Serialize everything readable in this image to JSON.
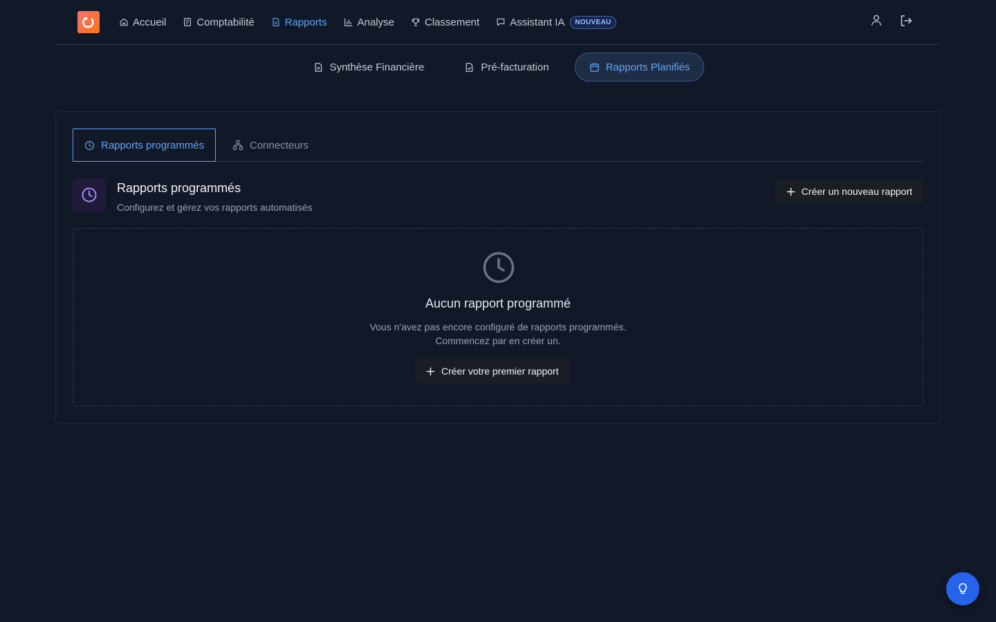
{
  "nav": {
    "items": [
      {
        "label": "Accueil",
        "icon": "home-icon"
      },
      {
        "label": "Comptabilité",
        "icon": "receipt-icon"
      },
      {
        "label": "Rapports",
        "icon": "file-text-icon",
        "active": true
      },
      {
        "label": "Analyse",
        "icon": "bar-chart-icon"
      },
      {
        "label": "Classement",
        "icon": "trophy-icon"
      },
      {
        "label": "Assistant IA",
        "icon": "chat-icon"
      }
    ],
    "badge": "NOUVEAU",
    "active_color": "#60a5fa"
  },
  "subnav": {
    "tabs": [
      {
        "label": "Synthèse Financière",
        "icon": "file-text-icon"
      },
      {
        "label": "Pré-facturation",
        "icon": "file-check-icon"
      },
      {
        "label": "Rapports Planifiés",
        "icon": "calendar-icon",
        "active": true
      }
    ]
  },
  "card": {
    "tabs": [
      {
        "label": "Rapports programmés",
        "icon": "clock-icon",
        "active": true
      },
      {
        "label": "Connecteurs",
        "icon": "network-icon"
      }
    ],
    "section": {
      "title": "Rapports programmés",
      "subtitle": "Configurez et gérez vos rapports automatisés",
      "new_button": "Créer un nouveau rapport"
    },
    "empty": {
      "title": "Aucun rapport programmé",
      "desc_line1": "Vous n'avez pas encore configuré de rapports programmés.",
      "desc_line2": "Commencez par en créer un.",
      "button": "Créer votre premier rapport"
    }
  },
  "colors": {
    "background": "#111827",
    "accent": "#60a5fa",
    "fab": "#2563eb",
    "logo_gradient": [
      "#f87171",
      "#f97316"
    ]
  }
}
